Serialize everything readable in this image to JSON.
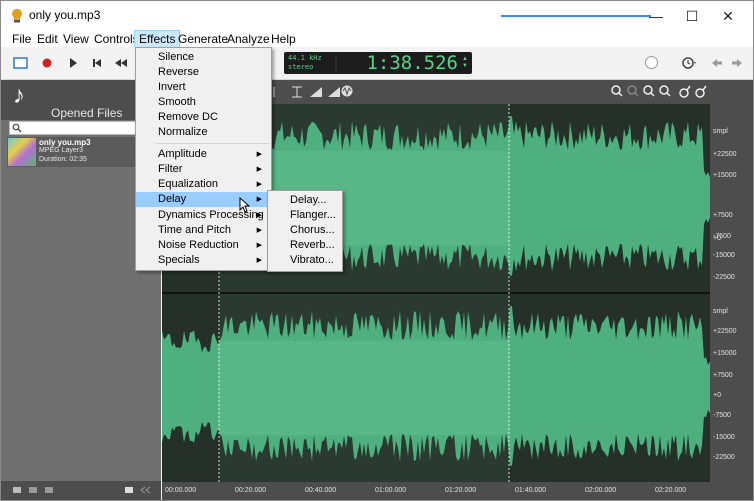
{
  "window": {
    "title": "only you.mp3",
    "controls": [
      "—",
      "☐",
      "✕"
    ]
  },
  "menubar": [
    "File",
    "Edit",
    "View",
    "Controls",
    "Effects",
    "Generate",
    "Analyze",
    "Help"
  ],
  "lcd": {
    "rate": "44.1 kHz",
    "channels": "stereo",
    "time": "1:38.526"
  },
  "left_panel": {
    "title": "Opened Files",
    "file": {
      "name": "only you.mp3",
      "format": "MPEG Layer3",
      "duration": "Duration: 02:35"
    }
  },
  "effects_menu": {
    "group1": [
      "Silence",
      "Reverse",
      "Invert",
      "Smooth",
      "Remove DC",
      "Normalize"
    ],
    "group2": [
      "Amplitude",
      "Filter",
      "Equalization",
      "Delay",
      "Dynamics Processing",
      "Time and Pitch",
      "Noise Reduction",
      "Specials"
    ],
    "highlighted": "Delay"
  },
  "delay_submenu": [
    "Delay...",
    "Flanger...",
    "Chorus...",
    "Reverb...",
    "Vibrato..."
  ],
  "scale": {
    "top": [
      "smpl",
      "+22500",
      "+15000",
      "+7500",
      "+0",
      "-7500",
      "-15000",
      "-22500"
    ],
    "bottom": [
      "smpl",
      "+22500",
      "+15000",
      "+7500",
      "+0",
      "-7500",
      "-15000",
      "-22500"
    ]
  },
  "timeline": [
    "00:00.000",
    "00:20.000",
    "00:40.000",
    "01:00.000",
    "01:20.000",
    "01:40.000",
    "02:00.000",
    "02:20.000"
  ],
  "colors": {
    "wave": "#4fb07f",
    "wave_selected": "#66c596",
    "lcd_text": "#58d489",
    "highlight": "#99ccff"
  }
}
